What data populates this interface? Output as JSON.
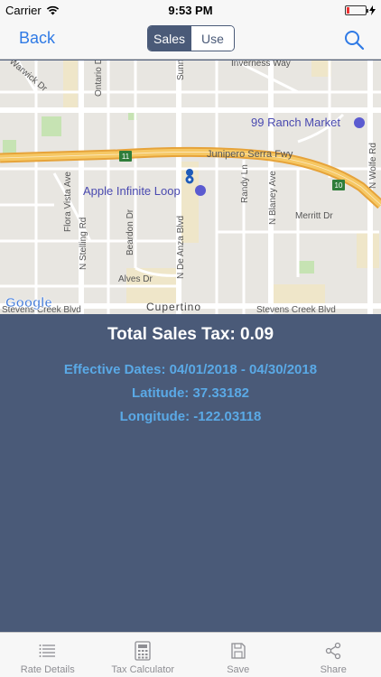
{
  "status_bar": {
    "carrier": "Carrier",
    "time": "9:53 PM"
  },
  "nav": {
    "back_label": "Back",
    "segments": [
      {
        "label": "Sales",
        "active": true
      },
      {
        "label": "Use",
        "active": false
      }
    ]
  },
  "map": {
    "labels": {
      "inverness": "Inverness Way",
      "ranch": "99 Ranch Market",
      "junipero": "Junipero Serra Fwy",
      "apple": "Apple Infinite Loop",
      "flora": "Flora Vista Ave",
      "stelling": "N Stelling Rd",
      "beardon": "Beardon Dr",
      "deanza": "N De Anza Blvd",
      "randy": "Randy Ln",
      "blaney": "N Blaney Ave",
      "merritt": "Merritt Dr",
      "wolfe": "N Wolfe Rd",
      "ontario": "Ontario Dr",
      "sunnyvale": "Sunnyvale",
      "warwick": "Warwick Dr",
      "alves": "Alves Dr",
      "cupertino": "Cupertino",
      "stevens_left": "Stevens Creek Blvd",
      "stevens_right": "Stevens Creek Blvd",
      "shield_11_left": "11",
      "shield_11_mid": "11",
      "shield_10": "10",
      "google": "Google"
    }
  },
  "info": {
    "total": "Total Sales Tax: 0.09",
    "effective": "Effective Dates: 04/01/2018 - 04/30/2018",
    "latitude": "Latitude: 37.33182",
    "longitude": "Longitude: -122.03118"
  },
  "tabs": [
    {
      "label": "Rate Details",
      "icon": "list-icon"
    },
    {
      "label": "Tax Calculator",
      "icon": "calculator-icon"
    },
    {
      "label": "Save",
      "icon": "save-icon"
    },
    {
      "label": "Share",
      "icon": "share-icon"
    }
  ],
  "colors": {
    "accent": "#2f7ae5",
    "panel": "#4a5a78",
    "info_text": "#5aa9e6",
    "highway": "#f2b84f"
  }
}
